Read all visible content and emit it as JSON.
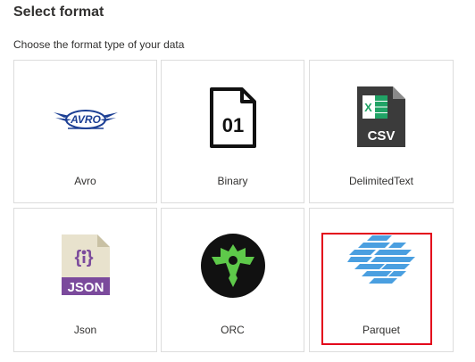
{
  "header": {
    "title": "Select format",
    "subtitle": "Choose the format type of your data"
  },
  "formats": [
    {
      "label": "Avro",
      "icon": "avro-logo-icon",
      "selected": false
    },
    {
      "label": "Binary",
      "icon": "binary-file-icon",
      "selected": false
    },
    {
      "label": "DelimitedText",
      "icon": "csv-file-icon",
      "selected": false
    },
    {
      "label": "Json",
      "icon": "json-file-icon",
      "selected": false
    },
    {
      "label": "ORC",
      "icon": "orc-logo-icon",
      "selected": false
    },
    {
      "label": "Parquet",
      "icon": "parquet-logo-icon",
      "selected": true
    }
  ],
  "icon_text": {
    "avro": "AVRO",
    "binary": "01",
    "csv": "CSV",
    "json_braces": "{ }",
    "json": "JSON"
  },
  "colors": {
    "highlight": "#e3001b",
    "tile_border": "#dcdcdc",
    "avro_blue": "#1c3f94",
    "csv_green": "#21a366",
    "json_purple": "#7b4a9c",
    "orc_green": "#5ec94a",
    "parquet_blue": "#4a9fe0"
  }
}
